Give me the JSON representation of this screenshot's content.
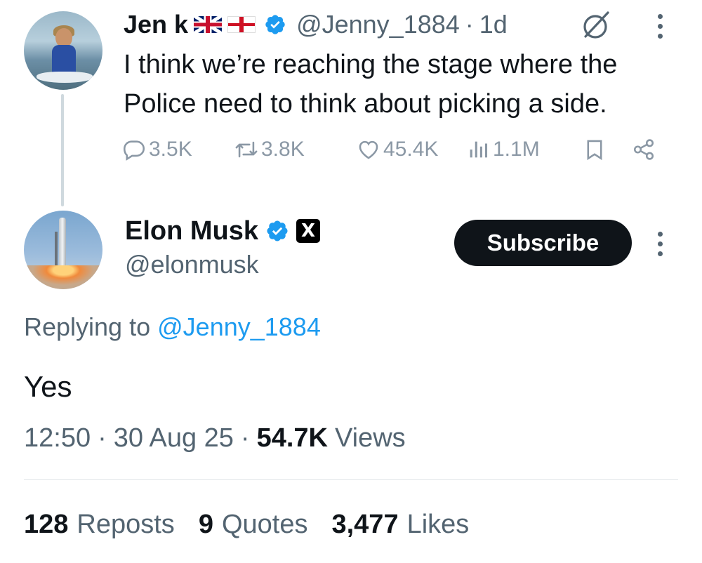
{
  "parent_tweet": {
    "author_name": "Jen k",
    "flags": [
      "uk-flag",
      "england-flag"
    ],
    "handle": "@Jenny_1884",
    "separator": "·",
    "time_ago": "1d",
    "text": "I think we’re reaching the stage where the Police need to think about picking a side.",
    "metrics": {
      "replies": "3.5K",
      "reposts": "3.8K",
      "likes": "45.4K",
      "views": "1.1M"
    }
  },
  "main_tweet": {
    "author_name": "Elon Musk",
    "handle": "@elonmusk",
    "badge_letter": "X",
    "subscribe_label": "Subscribe",
    "replying_prefix": "Replying to",
    "replying_to": "@Jenny_1884",
    "text": "Yes",
    "time": "12:50",
    "separator": "·",
    "date": "30 Aug 25",
    "views_count": "54.7K",
    "views_label": "Views",
    "stats": {
      "reposts_count": "128",
      "reposts_label": "Reposts",
      "quotes_count": "9",
      "quotes_label": "Quotes",
      "likes_count": "3,477",
      "likes_label": "Likes"
    }
  },
  "colors": {
    "text": "#0f1419",
    "muted": "#536471",
    "action_gray": "#8b98a5",
    "link_blue": "#1d9bf0",
    "verified_blue": "#1d9bf0",
    "button_bg": "#0f1419",
    "divider": "#dfe4e8"
  },
  "icons": [
    "verified-badge-icon",
    "grok-icon",
    "more-icon",
    "reply-icon",
    "repost-icon",
    "like-icon",
    "views-icon",
    "bookmark-icon",
    "share-icon",
    "x-logo-icon"
  ]
}
